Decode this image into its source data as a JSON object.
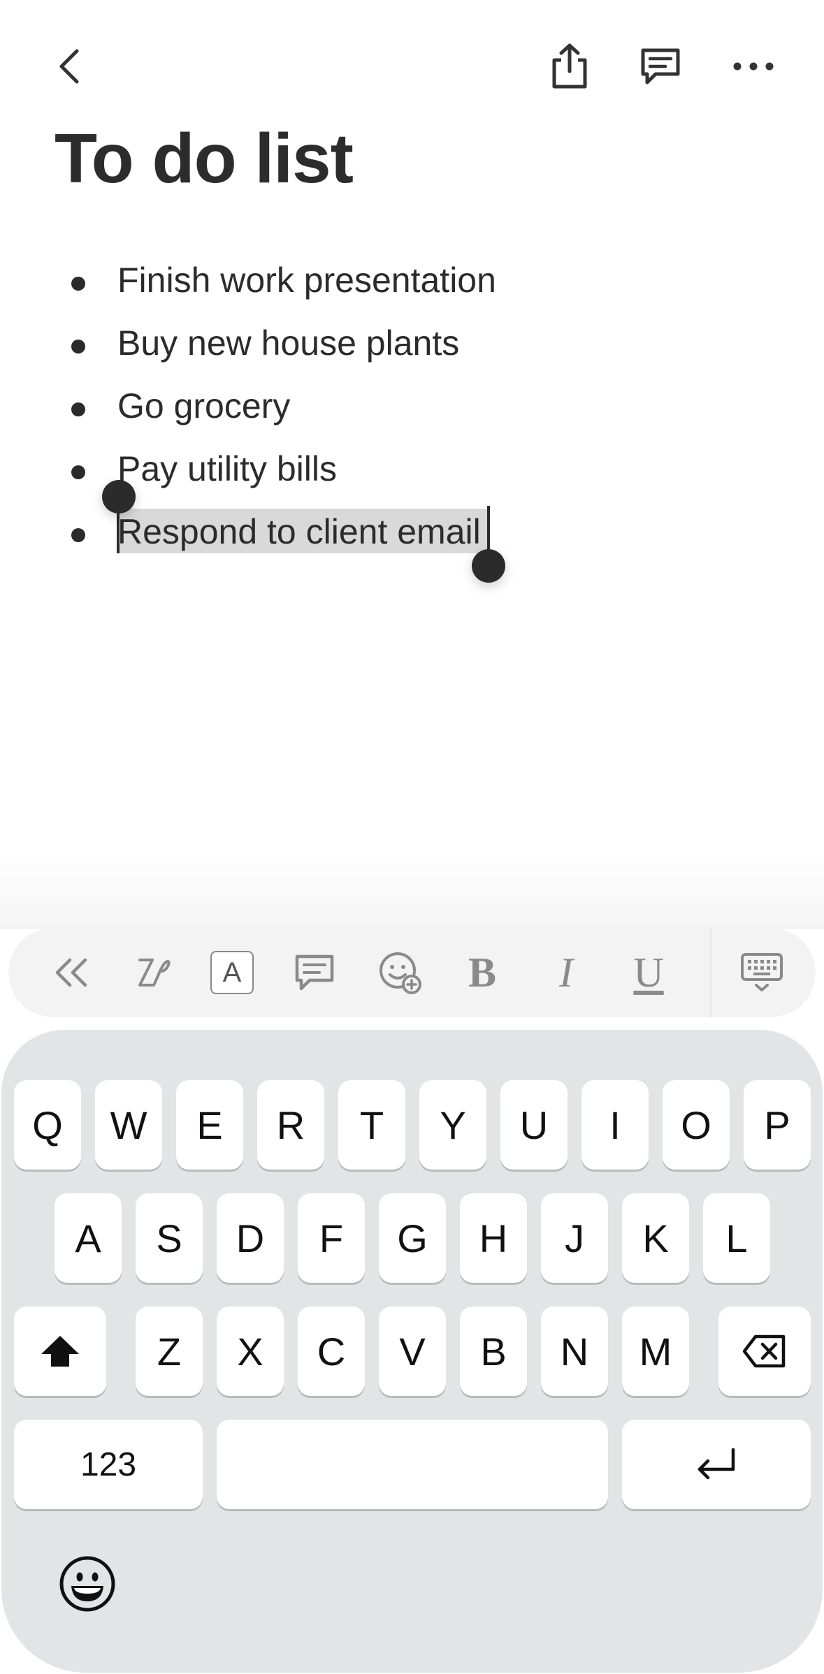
{
  "header": {
    "back_icon": "chevron-left-icon",
    "share_icon": "share-icon",
    "comment_icon": "comment-icon",
    "more_icon": "more-horizontal-icon"
  },
  "note": {
    "title": "To do list",
    "items": [
      "Finish work presentation",
      "Buy new house plants",
      "Go grocery",
      "Pay utility bills",
      "Respond to client email"
    ],
    "selected_item_index": 4
  },
  "format_toolbar": {
    "tools": [
      "collapse-icon",
      "handwriting-icon",
      "text-style-icon",
      "comment-icon",
      "emoji-add-icon",
      "bold-icon",
      "italic-icon",
      "underline-icon",
      "hide-keyboard-icon"
    ],
    "text_style_label": "A",
    "bold_label": "B",
    "italic_label": "I",
    "underline_label": "U"
  },
  "keyboard": {
    "row1": [
      "Q",
      "W",
      "E",
      "R",
      "T",
      "Y",
      "U",
      "I",
      "O",
      "P"
    ],
    "row2": [
      "A",
      "S",
      "D",
      "F",
      "G",
      "H",
      "J",
      "K",
      "L"
    ],
    "row3": [
      "Z",
      "X",
      "C",
      "V",
      "B",
      "N",
      "M"
    ],
    "numbers_label": "123",
    "shift_icon": "shift-icon",
    "delete_icon": "backspace-icon",
    "return_icon": "return-icon",
    "emoji_icon": "emoji-icon"
  }
}
